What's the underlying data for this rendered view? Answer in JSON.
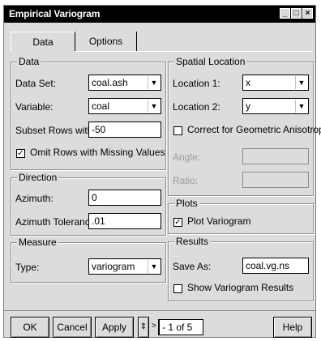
{
  "window": {
    "title": "Empirical Variogram",
    "controls": [
      "minimize-icon",
      "maximize-icon",
      "close-icon"
    ]
  },
  "tabs": [
    {
      "label": "Data",
      "active": true
    },
    {
      "label": "Options",
      "active": false
    }
  ],
  "data_group": {
    "title": "Data",
    "data_set_label": "Data Set:",
    "data_set_value": "coal.ash",
    "variable_label": "Variable:",
    "variable_value": "coal",
    "subset_label": "Subset Rows with:",
    "subset_value": "-50",
    "omit_label": "Omit Rows with Missing Values",
    "omit_checked": true
  },
  "direction_group": {
    "title": "Direction",
    "azimuth_label": "Azimuth:",
    "azimuth_value": "0",
    "tolerance_label": "Azimuth Tolerance:",
    "tolerance_value": ".01"
  },
  "measure_group": {
    "title": "Measure",
    "type_label": "Type:",
    "type_value": "variogram"
  },
  "spatial_group": {
    "title": "Spatial Location",
    "loc1_label": "Location 1:",
    "loc1_value": "x",
    "loc2_label": "Location 2:",
    "loc2_value": "y",
    "correct_label": "Correct for Geometric Anisotropy",
    "correct_checked": false,
    "angle_label": "Angle:",
    "ratio_label": "Ratio:"
  },
  "plots_group": {
    "title": "Plots",
    "plot_label": "Plot Variogram",
    "plot_checked": true
  },
  "results_group": {
    "title": "Results",
    "save_label": "Save As:",
    "save_value": "coal.vg.ns",
    "show_label": "Show Variogram Results",
    "show_checked": false
  },
  "footer": {
    "ok": "OK",
    "cancel": "Cancel",
    "apply": "Apply",
    "page": "- 1 of  5",
    "help": "Help"
  }
}
